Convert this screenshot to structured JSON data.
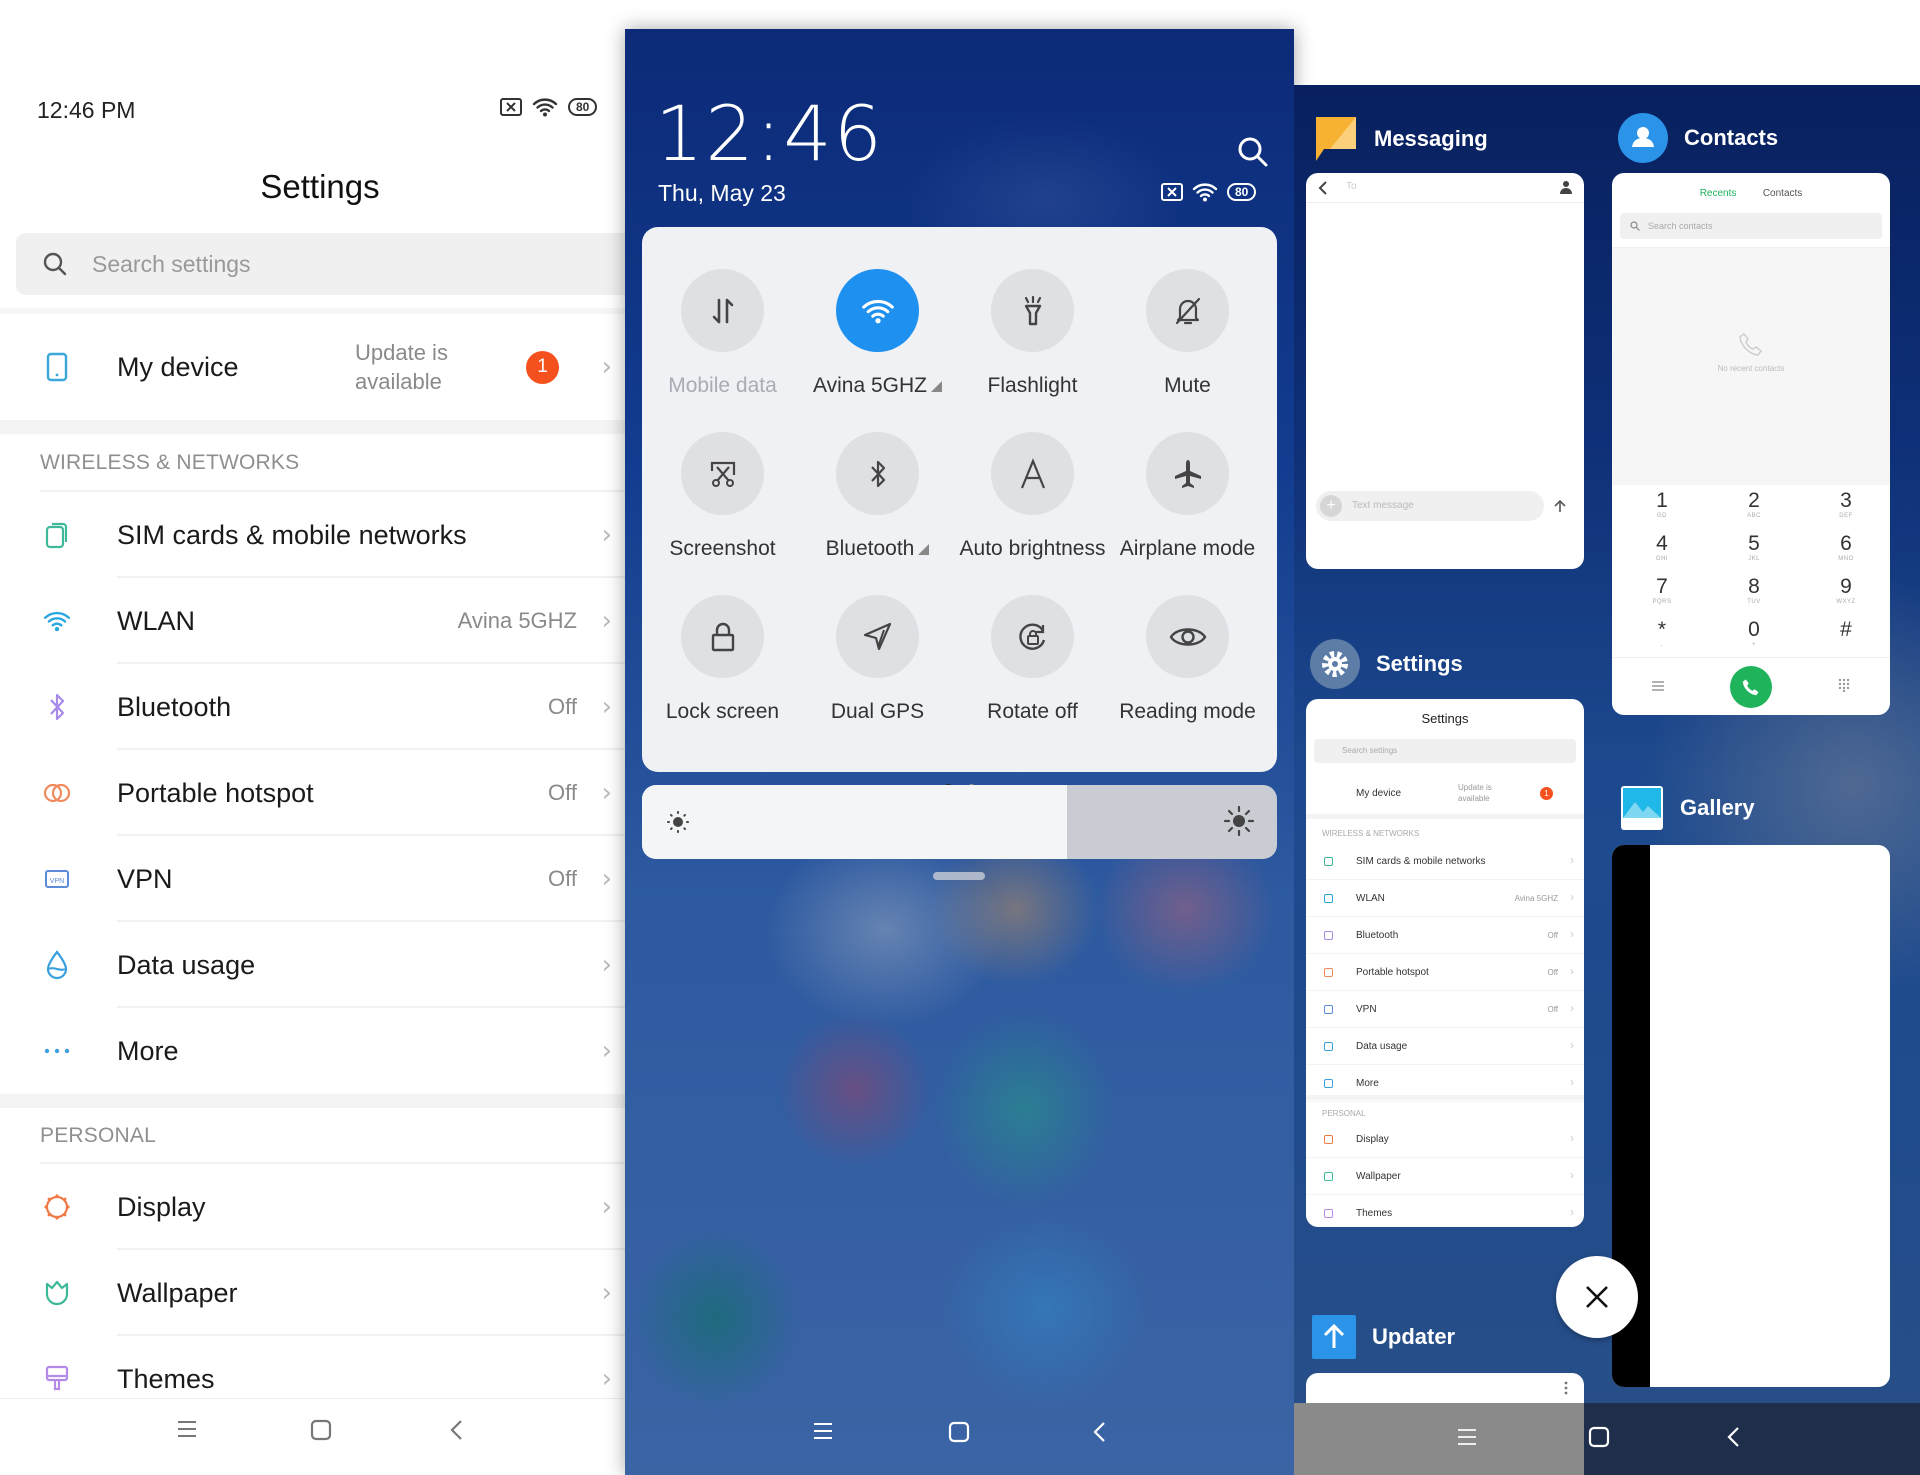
{
  "left_screen": {
    "status_bar": {
      "time": "12:46 PM",
      "battery": "80",
      "icons": [
        "sim-off-icon",
        "wifi-icon",
        "battery-icon"
      ]
    },
    "title": "Settings",
    "search": {
      "placeholder": "Search settings",
      "icon": "search-icon"
    },
    "my_device": {
      "label": "My device",
      "value": "Update is available",
      "value_line1": "Update is",
      "value_line2": "available",
      "badge": "1",
      "icon": "phone-icon"
    },
    "sections": [
      {
        "header": "WIRELESS & NETWORKS",
        "items": [
          {
            "label": "SIM cards & mobile networks",
            "value": "",
            "icon": "sim-cards-icon",
            "color": "#3fb89a"
          },
          {
            "label": "WLAN",
            "value": "Avina 5GHZ",
            "icon": "wifi-icon",
            "color": "#2aa7e0"
          },
          {
            "label": "Bluetooth",
            "value": "Off",
            "icon": "bluetooth-icon",
            "color": "#a88be8"
          },
          {
            "label": "Portable hotspot",
            "value": "Off",
            "icon": "hotspot-icon",
            "color": "#f08a5d"
          },
          {
            "label": "VPN",
            "value": "Off",
            "icon": "vpn-icon",
            "color": "#5b8bd9"
          },
          {
            "label": "Data usage",
            "value": "",
            "icon": "data-usage-icon",
            "color": "#3aa0dd"
          },
          {
            "label": "More",
            "value": "",
            "icon": "more-icon",
            "color": "#3aa0dd"
          }
        ]
      },
      {
        "header": "PERSONAL",
        "items": [
          {
            "label": "Display",
            "value": "",
            "icon": "display-icon",
            "color": "#f07a46"
          },
          {
            "label": "Wallpaper",
            "value": "",
            "icon": "wallpaper-icon",
            "color": "#3fb89a"
          },
          {
            "label": "Themes",
            "value": "",
            "icon": "themes-icon",
            "color": "#b38ae8"
          }
        ]
      }
    ],
    "nav": [
      "menu-icon",
      "home-icon",
      "back-icon"
    ]
  },
  "control_center": {
    "time": "12:46",
    "date": "Thu, May 23",
    "battery": "80",
    "tiles": [
      {
        "label": "Mobile data",
        "icon": "mobile-data-icon",
        "active": false,
        "disabled": true,
        "expandable": false
      },
      {
        "label": "Avina 5GHZ",
        "icon": "wifi-icon",
        "active": true,
        "disabled": false,
        "expandable": true
      },
      {
        "label": "Flashlight",
        "icon": "flashlight-icon",
        "active": false,
        "disabled": false,
        "expandable": false
      },
      {
        "label": "Mute",
        "icon": "mute-icon",
        "active": false,
        "disabled": false,
        "expandable": false
      },
      {
        "label": "Screenshot",
        "icon": "screenshot-icon",
        "active": false,
        "disabled": false,
        "expandable": false
      },
      {
        "label": "Bluetooth",
        "icon": "bluetooth-icon",
        "active": false,
        "disabled": false,
        "expandable": true
      },
      {
        "label": "Auto brightness",
        "icon": "auto-brightness-icon",
        "active": false,
        "disabled": false,
        "expandable": false
      },
      {
        "label": "Airplane mode",
        "icon": "airplane-icon",
        "active": false,
        "disabled": false,
        "expandable": false
      },
      {
        "label": "Lock screen",
        "icon": "lock-icon",
        "active": false,
        "disabled": false,
        "expandable": false
      },
      {
        "label": "Dual GPS",
        "icon": "gps-icon",
        "active": false,
        "disabled": false,
        "expandable": false
      },
      {
        "label": "Rotate off",
        "icon": "rotate-lock-icon",
        "active": false,
        "disabled": false,
        "expandable": false
      },
      {
        "label": "Reading mode",
        "icon": "eye-icon",
        "active": false,
        "disabled": false,
        "expandable": false
      }
    ],
    "page_indicator": {
      "current": 1,
      "total": 2
    },
    "brightness": {
      "value": 0.67
    },
    "active_color": "#1e90f0"
  },
  "recents": {
    "apps": [
      {
        "name": "Messaging",
        "icon": "messaging-icon",
        "preview": {
          "to_placeholder": "To",
          "input_placeholder": "Text message"
        }
      },
      {
        "name": "Contacts",
        "icon": "contacts-icon",
        "preview": {
          "tabs": [
            "Recents",
            "Contacts"
          ],
          "active_tab": "Recents",
          "search_placeholder": "Search contacts",
          "empty_text": "No recent contacts",
          "keys": [
            {
              "d": "1",
              "s": "GD"
            },
            {
              "d": "2",
              "s": "ABC"
            },
            {
              "d": "3",
              "s": "DEF"
            },
            {
              "d": "4",
              "s": "GHI"
            },
            {
              "d": "5",
              "s": "JKL"
            },
            {
              "d": "6",
              "s": "MNO"
            },
            {
              "d": "7",
              "s": "PQRS"
            },
            {
              "d": "8",
              "s": "TUV"
            },
            {
              "d": "9",
              "s": "WXYZ"
            },
            {
              "d": "*",
              "s": ","
            },
            {
              "d": "0",
              "s": "+"
            },
            {
              "d": "#",
              "s": ""
            }
          ],
          "call_color": "#1fb35c"
        }
      },
      {
        "name": "Settings",
        "icon": "settings-icon",
        "preview": {
          "title": "Settings",
          "search_placeholder": "Search settings",
          "my_device": "My device",
          "update": "Update is available",
          "badge": "1",
          "section1": "WIRELESS & NETWORKS",
          "rows1": [
            {
              "label": "SIM cards & mobile networks",
              "value": ""
            },
            {
              "label": "WLAN",
              "value": "Avina 5GHZ"
            },
            {
              "label": "Bluetooth",
              "value": "Off"
            },
            {
              "label": "Portable hotspot",
              "value": "Off"
            },
            {
              "label": "VPN",
              "value": "Off"
            },
            {
              "label": "Data usage",
              "value": ""
            },
            {
              "label": "More",
              "value": ""
            }
          ],
          "section2": "PERSONAL",
          "rows2": [
            {
              "label": "Display",
              "value": ""
            },
            {
              "label": "Wallpaper",
              "value": ""
            },
            {
              "label": "Themes",
              "value": ""
            }
          ]
        }
      },
      {
        "name": "Gallery",
        "icon": "gallery-icon"
      },
      {
        "name": "Updater",
        "icon": "updater-icon"
      }
    ],
    "close_all_icon": "close-icon",
    "nav": [
      "menu-icon",
      "home-icon",
      "back-icon"
    ]
  }
}
